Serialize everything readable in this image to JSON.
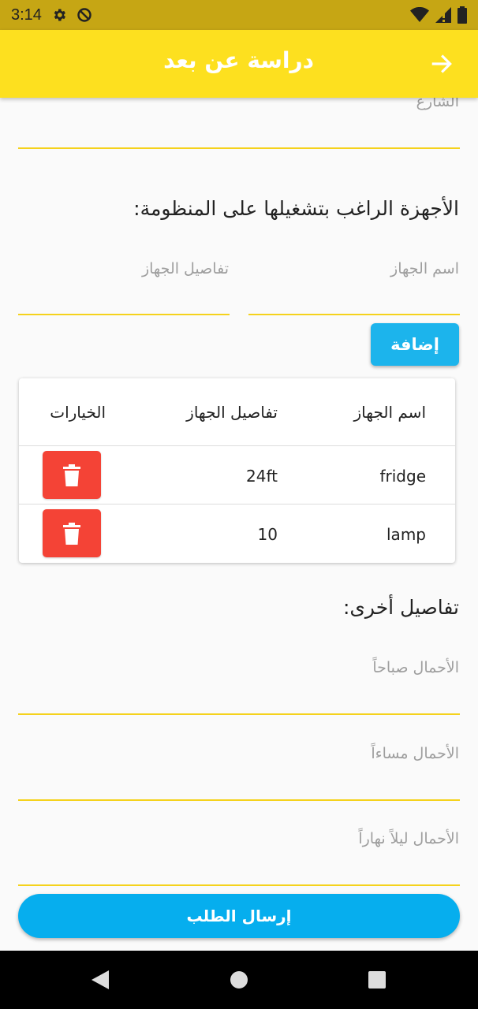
{
  "status_bar": {
    "time": "3:14",
    "icons": [
      "settings-icon",
      "do-not-disturb-icon",
      "wifi-icon",
      "signal-icon",
      "battery-icon"
    ]
  },
  "app_bar": {
    "title": "دراسة عن بعد",
    "back_icon": "arrow-right-icon"
  },
  "form": {
    "street_placeholder": "الشارع",
    "devices_heading": "الأجهزة الراغب بتشغيلها على المنظومة:",
    "device_name_placeholder": "اسم الجهاز",
    "device_details_placeholder": "تفاصيل الجهاز",
    "add_button": "إضافة"
  },
  "devices_table": {
    "headers": [
      "اسم الجهاز",
      "تفاصيل الجهاز",
      "الخيارات"
    ],
    "rows": [
      {
        "name": "fridge",
        "details": "24ft",
        "action": "delete-icon"
      },
      {
        "name": "lamp",
        "details": "10",
        "action": "delete-icon"
      }
    ]
  },
  "other_details": {
    "heading": "تفاصيل أخرى:",
    "morning_loads_placeholder": "الأحمال صباحاً",
    "evening_loads_placeholder": "الأحمال مساءاً",
    "day_night_loads_placeholder": "الأحمال ليلاً نهاراً"
  },
  "submit_button": "إرسال الطلب",
  "colors": {
    "status_bar": "#c6a614",
    "app_bar": "#fde01f",
    "underline": "#f5d21c",
    "add_button": "#1cb4ec",
    "delete_button": "#f44336",
    "submit_button": "#06aeee"
  },
  "nav_bar": {
    "icons": [
      "back-triangle-icon",
      "home-circle-icon",
      "recents-square-icon"
    ]
  }
}
